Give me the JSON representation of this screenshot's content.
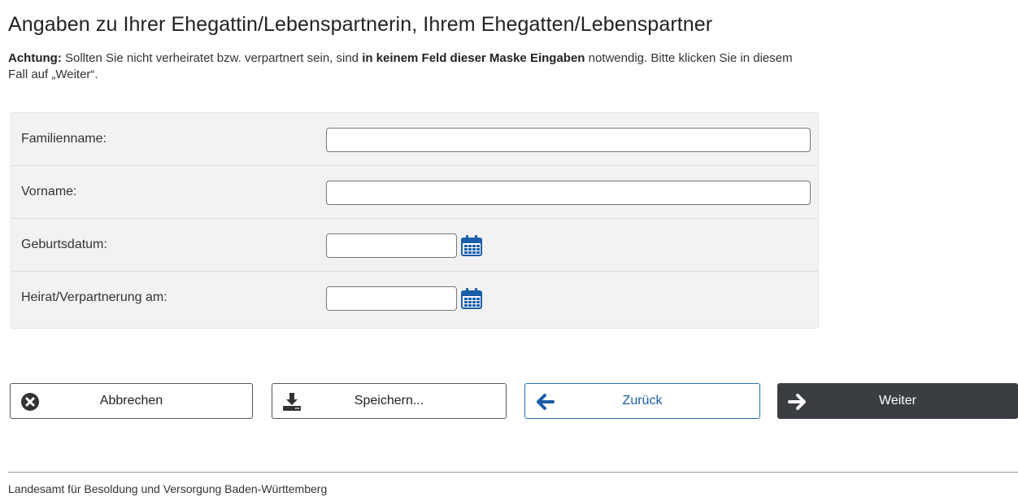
{
  "page": {
    "title": "Angaben zu Ihrer Ehegattin/Lebenspartnerin, Ihrem Ehegatten/Lebenspartner"
  },
  "notice": {
    "label": "Achtung:",
    "text_1": " Sollten Sie nicht verheiratet bzw. verpartnert sein, sind ",
    "emphasis": "in keinem Feld dieser Maske Eingaben",
    "text_2": " notwendig. Bitte klicken Sie in diesem Fall auf „Weiter“."
  },
  "form": {
    "familienname": {
      "label": "Familienname:",
      "value": ""
    },
    "vorname": {
      "label": "Vorname:",
      "value": ""
    },
    "geburtsdatum": {
      "label": "Geburtsdatum:",
      "value": "",
      "icon": "calendar-icon"
    },
    "heirat": {
      "label": "Heirat/Verpartnerung am:",
      "value": "",
      "icon": "calendar-icon"
    }
  },
  "buttons": {
    "cancel": {
      "label": "Abbrechen",
      "icon": "times-circle-icon"
    },
    "save": {
      "label": "Speichern...",
      "icon": "download-icon"
    },
    "back": {
      "label": "Zurück",
      "icon": "arrow-left-icon"
    },
    "next": {
      "label": "Weiter",
      "icon": "arrow-right-icon"
    }
  },
  "colors": {
    "calendar_icon": "#1a5da8",
    "back_accent": "#1a5da8",
    "next_background": "#3a3d42"
  },
  "footer": {
    "text": "Landesamt für Besoldung und Versorgung Baden-Württemberg"
  }
}
